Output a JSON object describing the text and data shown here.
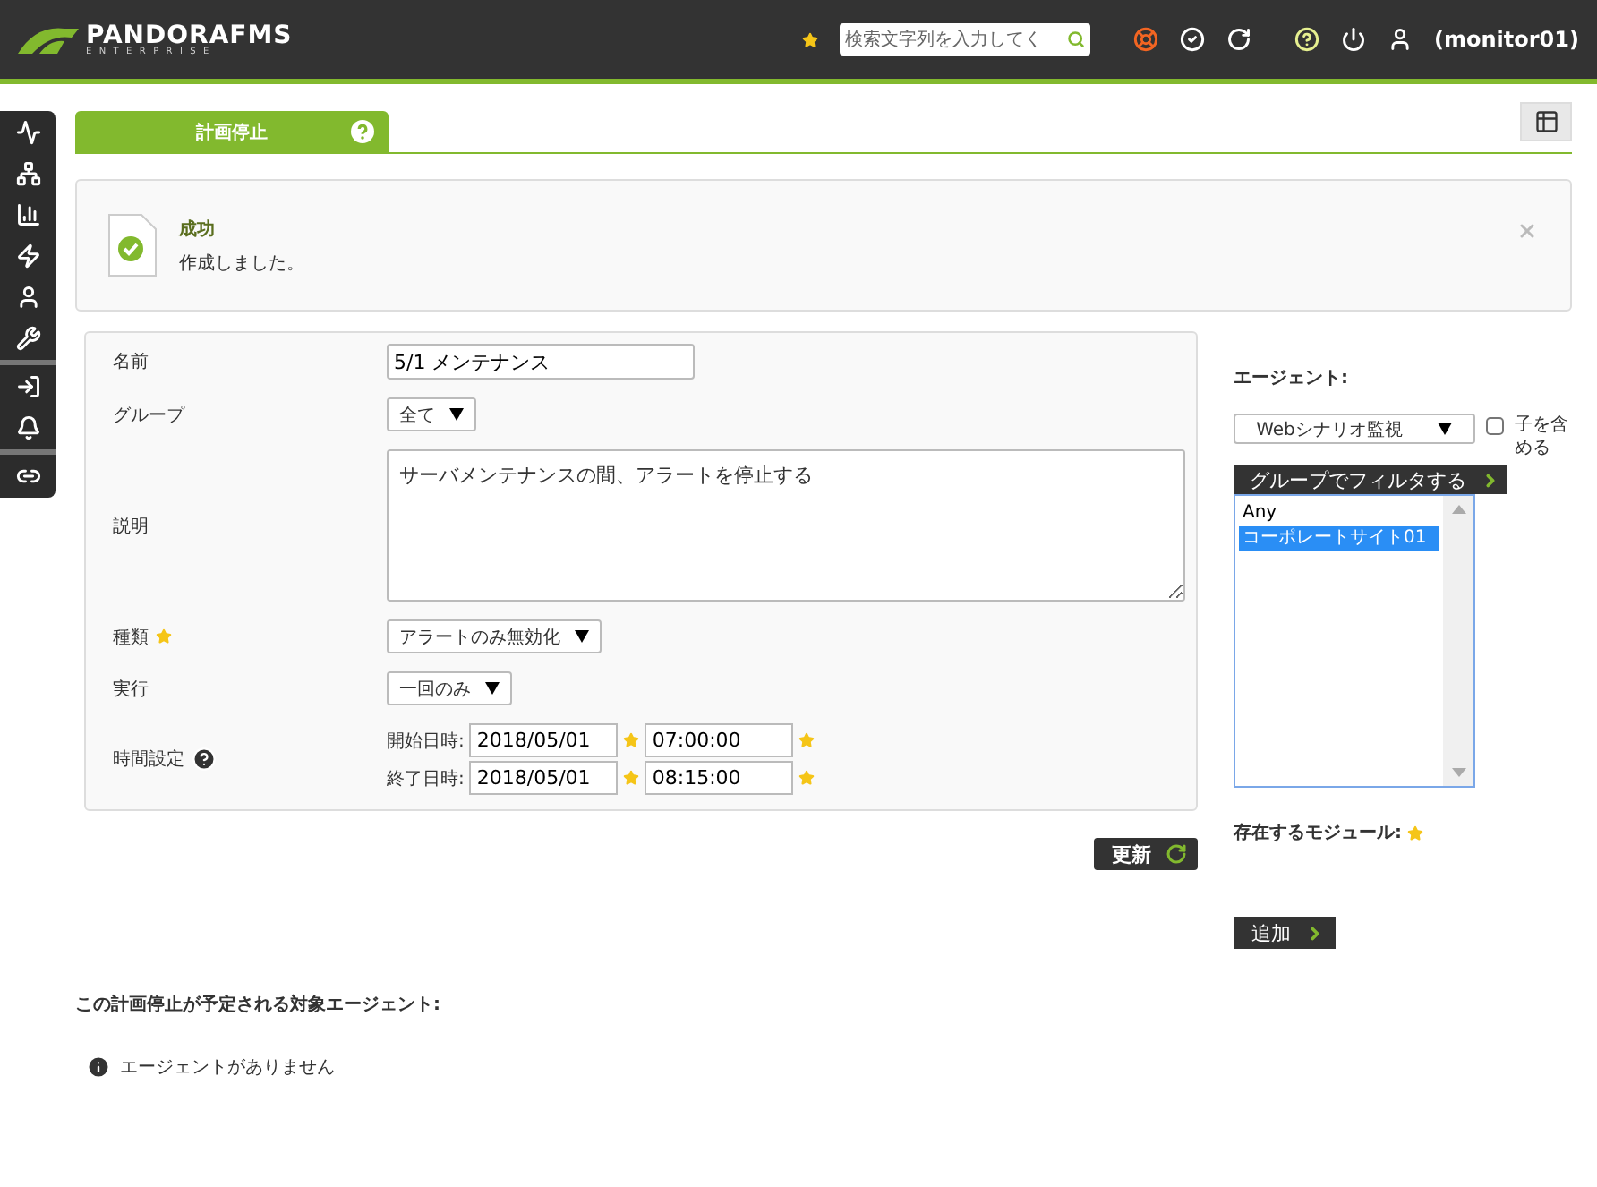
{
  "header": {
    "logo": {
      "name": "PANDORAFMS",
      "tagline": "ENTERPRISE"
    },
    "search": {
      "placeholder": "検索文字列を入力してく"
    },
    "user": "(monitor01)"
  },
  "tabs": [
    {
      "label": "計画停止",
      "selected": true
    }
  ],
  "message": {
    "title": "成功",
    "text": "作成しました。"
  },
  "form": {
    "rows": [
      {
        "kind": "text",
        "label": "名前",
        "value": "5/1 メンテナンス",
        "required": false
      },
      {
        "kind": "select",
        "label": "グループ",
        "value": "全て",
        "required": false
      },
      {
        "kind": "textarea",
        "label": "説明",
        "value": "サーバメンテナンスの間、アラートを停止する",
        "required": false
      },
      {
        "kind": "select",
        "label": "種類",
        "value": "アラートのみ無効化",
        "required": true
      },
      {
        "kind": "select",
        "label": "実行",
        "value": "一回のみ",
        "required": false
      },
      {
        "kind": "dates",
        "label": "時間設定",
        "required": false,
        "lines": [
          {
            "label": "開始日時:",
            "date": "2018/05/01",
            "time": "07:00:00",
            "required": true
          },
          {
            "label": "終了日時:",
            "date": "2018/05/01",
            "time": "08:15:00",
            "required": true
          }
        ]
      }
    ],
    "button": "更新"
  },
  "agents": {
    "label": "エージェント:",
    "select": "Webシナリオ監視",
    "include_children": {
      "label": "子を含める",
      "checked": false
    },
    "filter_button": "グループでフィルタする",
    "list": [
      {
        "label": "Any",
        "selected": false
      },
      {
        "label": "コーポレートサイト01",
        "selected": true
      }
    ],
    "modules_label": "存在するモジュール:",
    "add_button": "追加"
  },
  "scheduled": {
    "heading": "この計画停止が予定される対象エージェント:",
    "empty": "エージェントがありません"
  }
}
